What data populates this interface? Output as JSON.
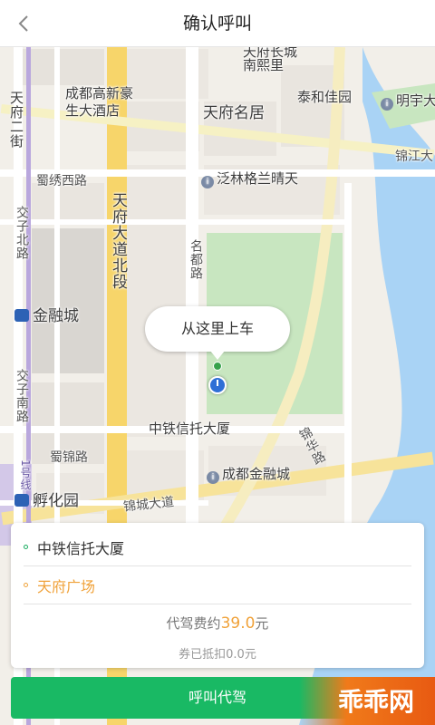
{
  "header": {
    "title": "确认呼叫",
    "back_icon": "chevron-left-icon"
  },
  "map": {
    "labels": {
      "tianfu_nanxili": "天府长城",
      "nanxili": "南熙里",
      "gaoxin_hotel": "成都高新豪\n生大酒店",
      "tianfu_mingju": "天府名居",
      "taihe": "泰和佳园",
      "mingyu": "明宇大",
      "jinjiang": "锦江大",
      "shuxiu_road": "蜀绣西路",
      "fanlin": "泛林格兰晴天",
      "tianfu_ave": "天府大道北段",
      "jiaozi_north": "交子北路",
      "tianfu_side": "天府二街",
      "mingdu_road": "名都路",
      "jinrong_city": "金融城",
      "jiaozi_south": "交子南路",
      "zhongtie_building": "中铁信托大厦",
      "shujin_road": "蜀锦路",
      "chengdu_jinrong": "成都金融城",
      "jinhua_road": "锦华路",
      "fuhua_park": "孵化园",
      "jincheng_ave": "锦城大道",
      "line1": "1号线"
    },
    "pickup_bubble": "从这里上车"
  },
  "order": {
    "origin": "中铁信托大厦",
    "destination": "天府广场",
    "fare_prefix": "代驾费约",
    "fare_amount": "39.0",
    "fare_suffix": "元",
    "coupon_text": "券已抵扣0.0元"
  },
  "actions": {
    "call_button": "呼叫代驾"
  },
  "watermark": {
    "text": "乖乖网"
  },
  "colors": {
    "accent_green": "#19b964",
    "accent_orange": "#f0a23a",
    "water": "#a9d3f5",
    "park": "#c8e6c0"
  }
}
